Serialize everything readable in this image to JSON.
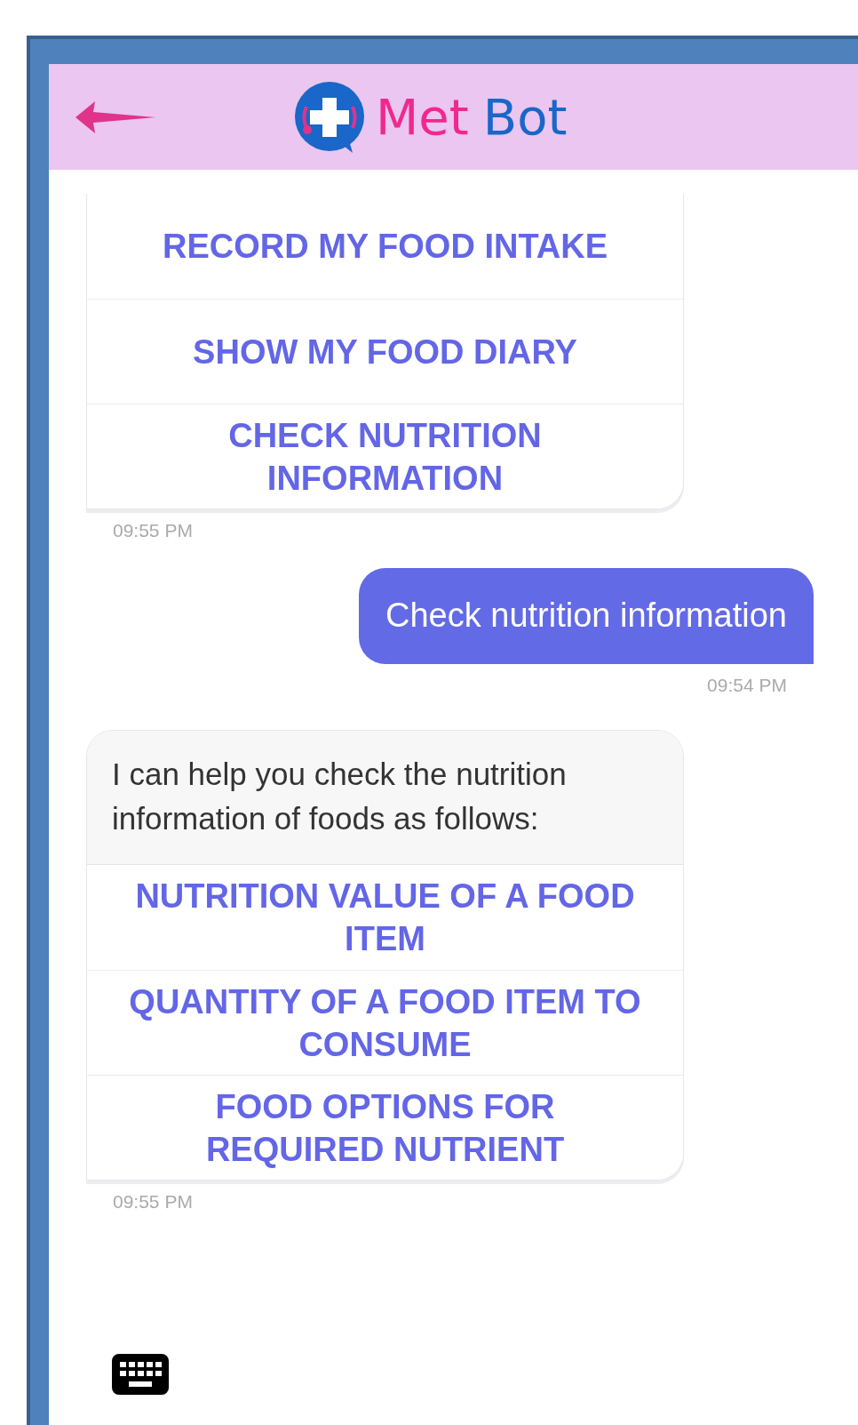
{
  "header": {
    "title_words": [
      "Met",
      "Bot"
    ]
  },
  "messages": [
    {
      "kind": "bot",
      "cut_top": true,
      "options": [
        "RECORD MY FOOD INTAKE",
        "SHOW MY FOOD DIARY",
        "CHECK NUTRITION INFORMATION"
      ],
      "time": "09:55 PM"
    },
    {
      "kind": "user",
      "text": "Check nutrition information",
      "time": "09:54 PM"
    },
    {
      "kind": "bot",
      "cut_top": false,
      "text": "I can help you check the nutrition information of foods as follows:",
      "options": [
        "NUTRITION VALUE OF A FOOD ITEM",
        "QUANTITY OF A FOOD ITEM TO CONSUME",
        "FOOD OPTIONS FOR REQUIRED NUTRIENT"
      ],
      "time": "09:55 PM"
    }
  ]
}
